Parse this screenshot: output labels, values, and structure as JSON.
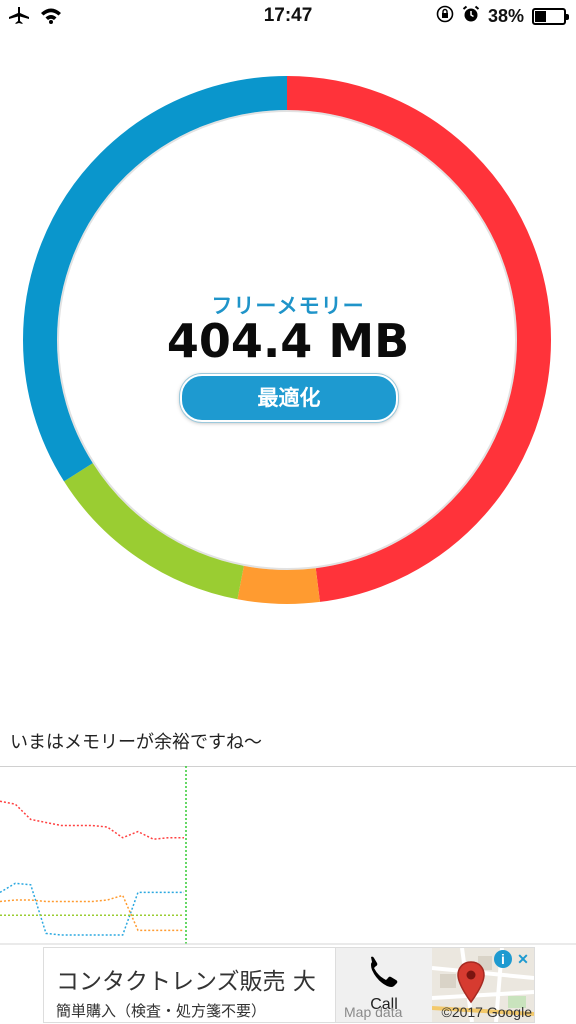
{
  "status_bar": {
    "time": "17:47",
    "battery_percent": "38%",
    "battery_level": 0.38,
    "icons": [
      "airplane-icon",
      "wifi-icon",
      "orientation-lock-icon",
      "alarm-icon",
      "battery-icon"
    ]
  },
  "memory_gauge": {
    "label": "フリーメモリー",
    "value": "404.4 MB",
    "optimize_label": "最適化",
    "segments": [
      {
        "color": "#ff333a",
        "fraction": 0.48
      },
      {
        "color": "#ff9b30",
        "fraction": 0.05
      },
      {
        "color": "#9acd32",
        "fraction": 0.13
      },
      {
        "color": "#0a96cc",
        "fraction": 0.34
      }
    ]
  },
  "message": "いまはメモリーが余裕ですね〜",
  "history_chart": {
    "series": [
      {
        "color": "#ff4040",
        "values": [
          90,
          88,
          78,
          76,
          74,
          74,
          74,
          73,
          66,
          70,
          65,
          66,
          66
        ]
      },
      {
        "color": "#2ba8e0",
        "values": [
          30,
          36,
          35,
          3,
          2,
          2,
          2,
          2,
          2,
          30,
          30,
          30,
          30
        ]
      },
      {
        "color": "#ff9b30",
        "values": [
          24,
          25,
          25,
          24,
          24,
          24,
          24,
          25,
          28,
          5,
          5,
          5,
          5
        ]
      },
      {
        "color": "#9acd32",
        "values": [
          15,
          15,
          15,
          15,
          15,
          15,
          15,
          15,
          15,
          15,
          15,
          15,
          15
        ]
      }
    ]
  },
  "ad": {
    "title": "コンタクトレンズ販売 大",
    "subtitle": "簡単購入（検査・処方箋不要）",
    "call_label": "Call",
    "map_data": "Map data",
    "map_credit": "©2017 Google",
    "info_symbol": "i",
    "close_symbol": "✕"
  }
}
